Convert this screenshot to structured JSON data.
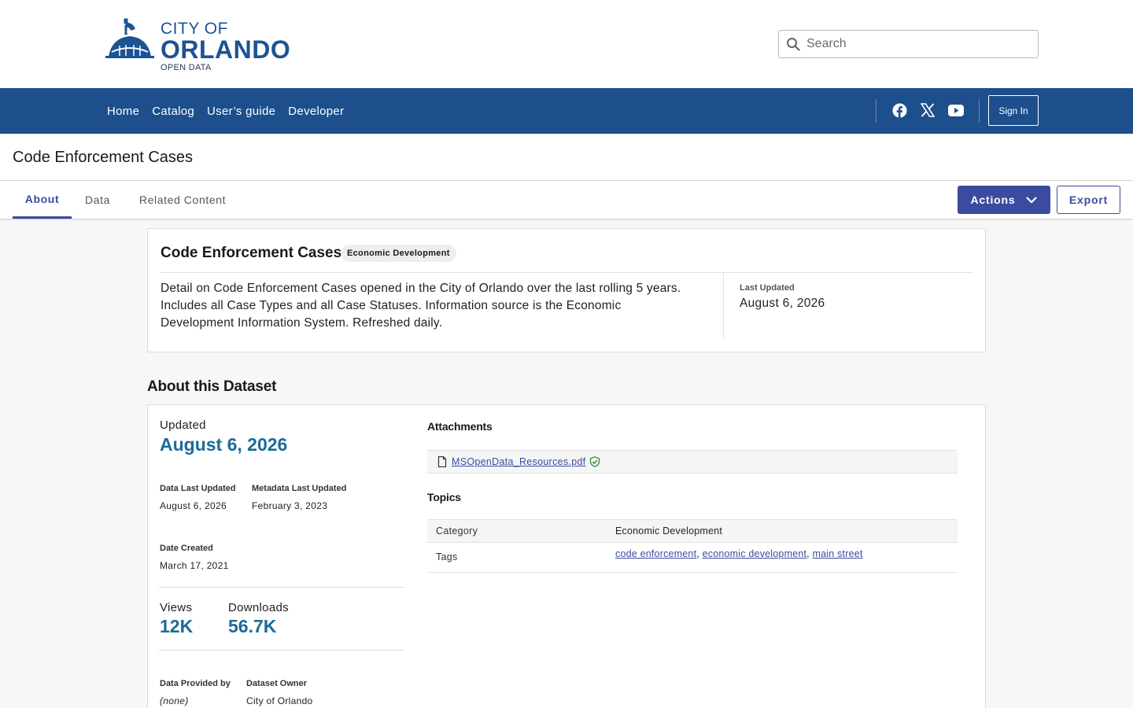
{
  "header": {
    "logo": {
      "line1": "CITY OF",
      "line2": "ORLANDO",
      "line3": "OPEN DATA"
    },
    "search": {
      "placeholder": "Search",
      "value": ""
    }
  },
  "nav": {
    "links": [
      "Home",
      "Catalog",
      "User’s guide",
      "Developer"
    ],
    "social": [
      "facebook-icon",
      "x-twitter-icon",
      "youtube-icon"
    ],
    "sign_in_label": "Sign In"
  },
  "page": {
    "title": "Code Enforcement Cases"
  },
  "tabs": {
    "items": [
      "About",
      "Data",
      "Related Content"
    ],
    "active": "About",
    "actions_label": "Actions",
    "export_label": "Export"
  },
  "summary": {
    "title": "Code Enforcement Cases",
    "category_badge": "Economic Development",
    "description": "Detail on Code Enforcement Cases opened in the City of Orlando over the last rolling 5 years. Includes all Case Types and all Case Statuses. Information source is the Economic Development Information System. Refreshed daily.",
    "last_updated_label": "Last Updated",
    "last_updated_value": "August 6, 2026"
  },
  "about": {
    "heading": "About this Dataset",
    "updated_label": "Updated",
    "updated_value": "August 6, 2026",
    "data_last_updated_label": "Data Last Updated",
    "data_last_updated_value": "August 6, 2026",
    "metadata_last_updated_label": "Metadata Last Updated",
    "metadata_last_updated_value": "February 3, 2023",
    "date_created_label": "Date Created",
    "date_created_value": "March 17, 2021",
    "views_label": "Views",
    "views_value": "12K",
    "downloads_label": "Downloads",
    "downloads_value": "56.7K",
    "provided_by_label": "Data Provided by",
    "provided_by_value": "(none)",
    "owner_label": "Dataset Owner",
    "owner_value": "City of Orlando",
    "attachments_heading": "Attachments",
    "attachment_file": "MSOpenData_Resources.pdf",
    "topics_heading": "Topics",
    "category_key": "Category",
    "category_value": "Economic Development",
    "tags_key": "Tags",
    "tags": [
      "code enforcement",
      "economic development",
      "main street"
    ]
  },
  "colors": {
    "brand_blue": "#1c4f8c",
    "accent_indigo": "#3b4ba0",
    "stat_blue": "#1c6a98"
  }
}
